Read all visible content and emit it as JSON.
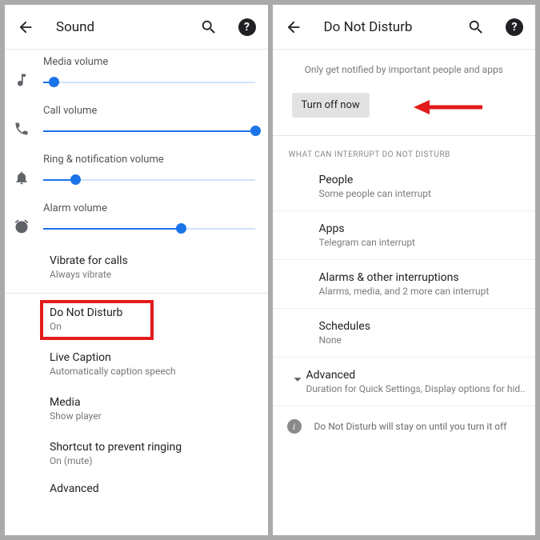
{
  "left": {
    "title": "Sound",
    "sliders": {
      "media": {
        "label": "Media volume",
        "value": 5
      },
      "call": {
        "label": "Call volume",
        "value": 100
      },
      "ring": {
        "label": "Ring & notification volume",
        "value": 15
      },
      "alarm": {
        "label": "Alarm volume",
        "value": 65
      }
    },
    "items": {
      "vibrate": {
        "primary": "Vibrate for calls",
        "secondary": "Always vibrate"
      },
      "dnd": {
        "primary": "Do Not Disturb",
        "secondary": "On"
      },
      "caption": {
        "primary": "Live Caption",
        "secondary": "Automatically caption speech"
      },
      "media": {
        "primary": "Media",
        "secondary": "Show player"
      },
      "shortcut": {
        "primary": "Shortcut to prevent ringing",
        "secondary": "On (mute)"
      },
      "advanced": {
        "primary": "Advanced"
      }
    }
  },
  "right": {
    "title": "Do Not Disturb",
    "intro": "Only get notified by important people and apps",
    "turn_off": "Turn off now",
    "section_header": "WHAT CAN INTERRUPT DO NOT DISTURB",
    "rows": {
      "people": {
        "primary": "People",
        "secondary": "Some people can interrupt"
      },
      "apps": {
        "primary": "Apps",
        "secondary": "Telegram can interrupt"
      },
      "alarms": {
        "primary": "Alarms & other interruptions",
        "secondary": "Alarms, media, and 2 more can interrupt"
      },
      "schedules": {
        "primary": "Schedules",
        "secondary": "None"
      },
      "advanced": {
        "primary": "Advanced",
        "secondary": "Duration for Quick Settings, Display options for hid.."
      }
    },
    "info": "Do Not Disturb will stay on until you turn it off"
  }
}
